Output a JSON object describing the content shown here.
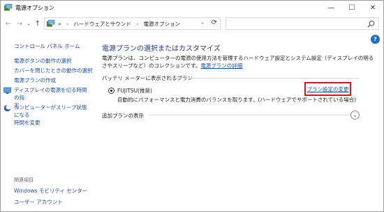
{
  "window": {
    "title": "電源オプション",
    "minimize": "—",
    "maximize": "☐",
    "close": "✕"
  },
  "nav": {
    "back": "←",
    "forward": "→",
    "recent": "⌄",
    "up": "↑",
    "address_prefix": "«",
    "breadcrumb": [
      "ハードウェアとサウンド",
      "電源オプション"
    ],
    "separator": "›",
    "dropdown": "⌄",
    "refresh": "⟳",
    "search_placeholder": ""
  },
  "help": "?",
  "sidebar": {
    "home": "コントロール パネル ホーム",
    "links": [
      {
        "label": "電源ボタンの動作の選択",
        "icon": ""
      },
      {
        "label": "カバーを閉じたときの動作の選択",
        "icon": ""
      },
      {
        "label": "電源プランの作成",
        "icon": ""
      },
      {
        "label": "ディスプレイの電源を切る時間の指\n定",
        "icon": "display-shield-icon"
      },
      {
        "label": "コンピューターがスリープ状態になる\n時間を変更",
        "icon": "moon-icon"
      }
    ],
    "related_header": "関連項目",
    "related": [
      "Windows モビリティ センター",
      "ユーザー アカウント"
    ]
  },
  "main": {
    "title": "電源プランの選択またはカスタマイズ",
    "description": "電源プランは、コンピューターの電源の使用方法を管理するハードウェア設定とシステム設定（ディスプレイの明るさやスリープなど）のコレクションです。",
    "description_link": "電源プランの詳細",
    "group_header": "バッテリ メーターに表示されるプラン",
    "plan": {
      "name": "FUJITSU(推奨)",
      "selected": true,
      "description": "自動的にパフォーマンスと電力消費のバランスを取ります。(ハードウェアでサポートされている場合)",
      "change_link": "プラン設定の変更"
    },
    "additional_plans": "追加プランの表示",
    "expand": "⌄"
  },
  "colors": {
    "link": "#1a4fa8",
    "heading": "#1e3a8a",
    "highlight_box": "#e0121a"
  }
}
